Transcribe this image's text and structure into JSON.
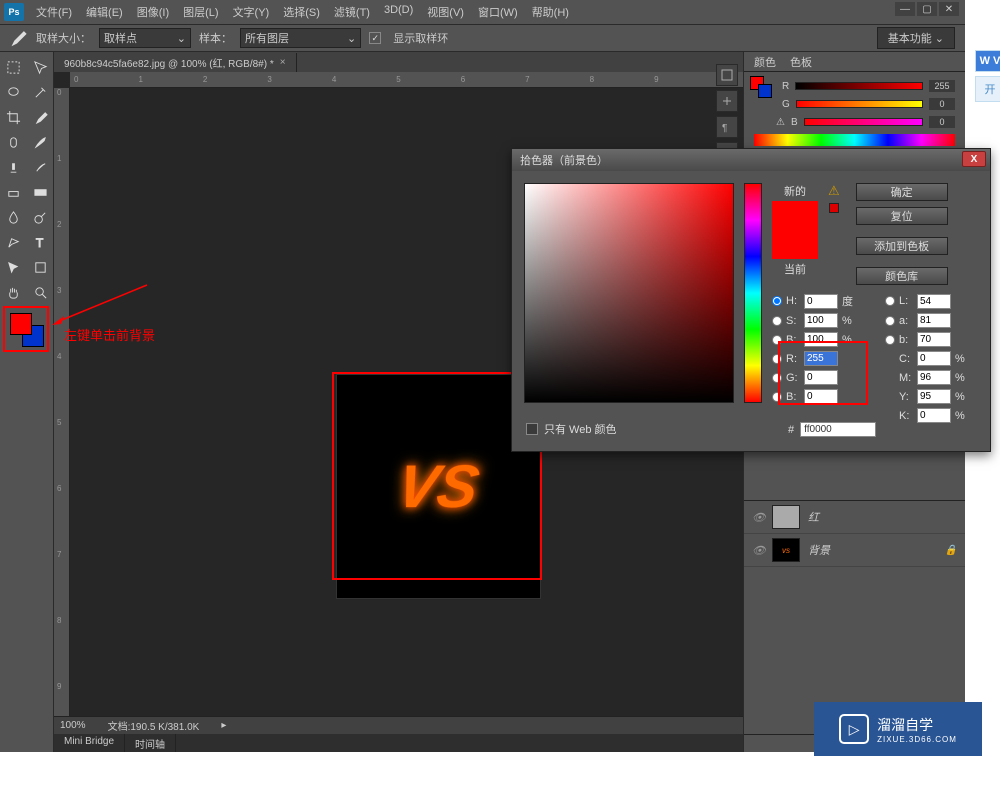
{
  "menu": {
    "file": "文件(F)",
    "edit": "编辑(E)",
    "image": "图像(I)",
    "layer": "图层(L)",
    "type": "文字(Y)",
    "select": "选择(S)",
    "filter": "滤镜(T)",
    "threeD": "3D(D)",
    "view": "视图(V)",
    "window": "窗口(W)",
    "help": "帮助(H)"
  },
  "optbar": {
    "sample_size_lbl": "取样大小：",
    "sample_size": "取样点",
    "sample_lbl": "样本：",
    "sample": "所有图层",
    "ring": "显示取样环",
    "workspace": "基本功能"
  },
  "tab": {
    "title": "960b8c94c5fa6e82.jpg @ 100% (红, RGB/8#) *"
  },
  "annotation": "左键单击前背景",
  "status": {
    "zoom": "100%",
    "doc": "文档:190.5 K/381.0K"
  },
  "bottom_tabs": {
    "mb": "Mini Bridge",
    "tl": "时间轴"
  },
  "rp": {
    "tab1": "颜色",
    "tab2": "色板",
    "r_lbl": "R",
    "g_lbl": "G",
    "b_lbl": "B",
    "r_val": "255",
    "g_val": "0",
    "b_val": "0"
  },
  "layers": {
    "l1": "红",
    "l2": "背景"
  },
  "dlg": {
    "title": "拾色器（前景色）",
    "new": "新的",
    "current": "当前",
    "ok": "确定",
    "cancel": "复位",
    "add": "添加到色板",
    "lib": "颜色库",
    "H": "H:",
    "Hv": "0",
    "Hu": "度",
    "S": "S:",
    "Sv": "100",
    "Su": "%",
    "Br": "B:",
    "Brv": "100",
    "Bru": "%",
    "R": "R:",
    "Rv": "255",
    "G": "G:",
    "Gv": "0",
    "B": "B:",
    "Bv": "0",
    "L": "L:",
    "Lv": "54",
    "a": "a:",
    "av": "81",
    "b2": "b:",
    "b2v": "70",
    "C": "C:",
    "Cv": "0",
    "Cu": "%",
    "M": "M:",
    "Mv": "96",
    "Mu": "%",
    "Y": "Y:",
    "Yv": "95",
    "Yu": "%",
    "K": "K:",
    "Kv": "0",
    "Ku": "%",
    "webonly": "只有 Web 颜色",
    "hash": "#",
    "hex": "ff0000"
  },
  "watermark": {
    "name": "溜溜自学",
    "url": "ZIXUE.3D66.COM"
  },
  "side": {
    "wv": "W V",
    "open": "开"
  }
}
